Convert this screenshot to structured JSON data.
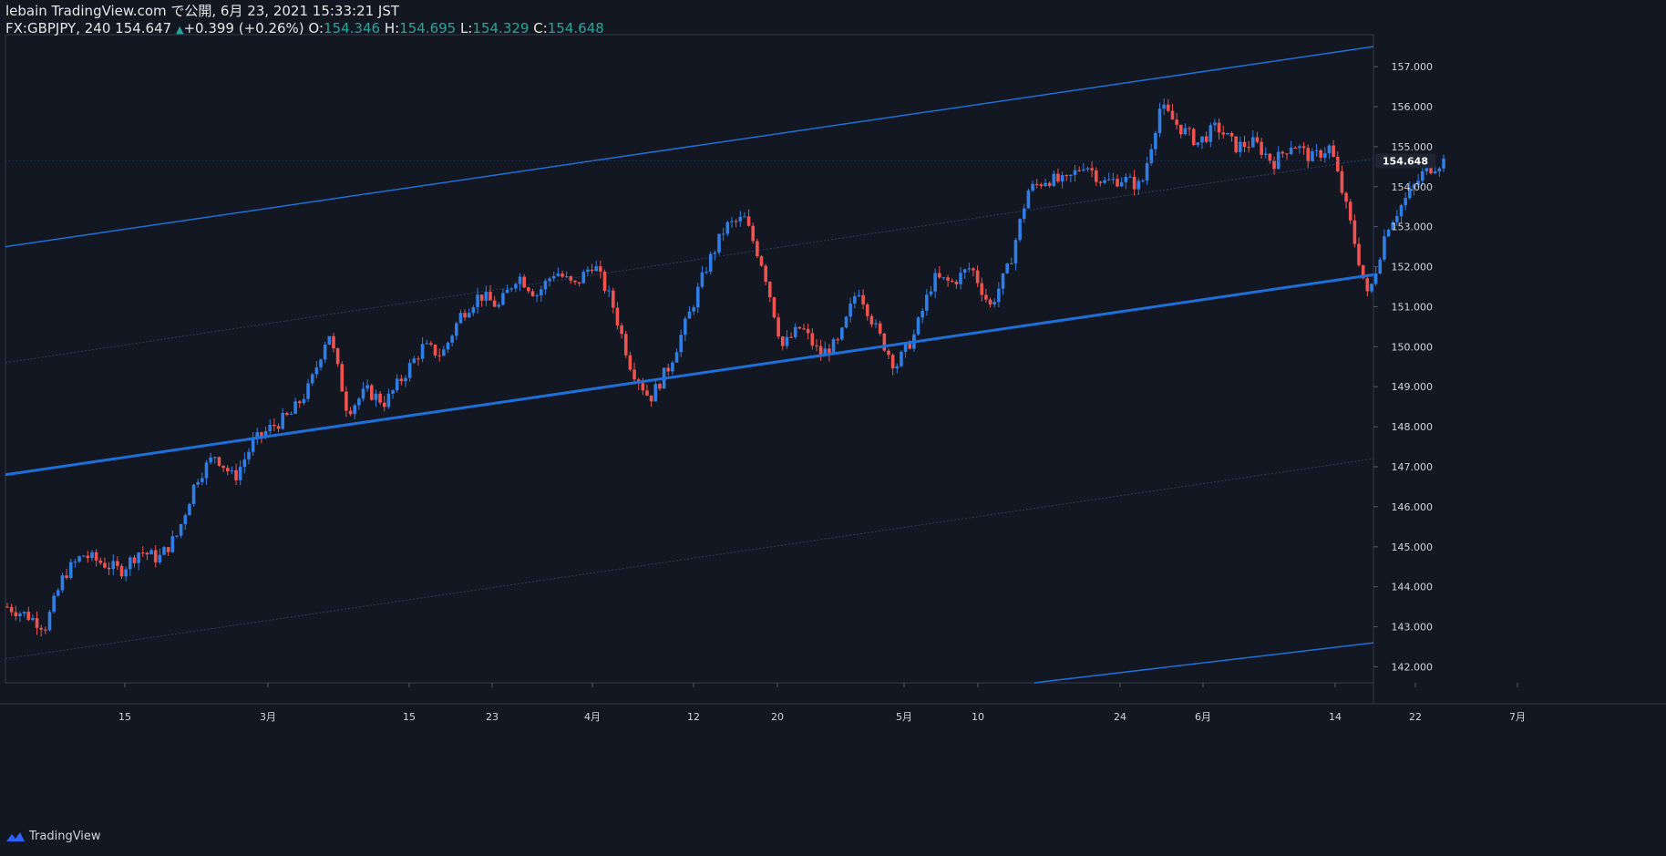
{
  "header": {
    "line1": "lebain TradingView.com で公開, 6月 23, 2021 15:33:21 JST",
    "symbol": "FX:GBPJPY, 240 154.647",
    "change_arrow": "▲",
    "change": "+0.399 (+0.26%)",
    "o_label": "O:",
    "o_value": "154.346",
    "h_label": "H:",
    "h_value": "154.695",
    "l_label": "L:",
    "l_value": "154.329",
    "c_label": "C:",
    "c_value": "154.648"
  },
  "footer": {
    "brand": "TradingView"
  },
  "colors": {
    "background": "#131722",
    "up": "#2962ff",
    "up_light": "#2f7ee6",
    "down": "#ef5350",
    "channel": "#1e6fd9",
    "axis_text": "#d1d4dc",
    "price_badge": "#1f2433"
  },
  "chart_data": {
    "type": "candlestick",
    "symbol": "FX:GBPJPY",
    "timeframe": "240",
    "y_axis": {
      "ticks": [
        "142.000",
        "143.000",
        "144.000",
        "145.000",
        "146.000",
        "147.000",
        "148.000",
        "149.000",
        "150.000",
        "151.000",
        "152.000",
        "153.000",
        "154.000",
        "155.000",
        "156.000",
        "157.000"
      ],
      "range": [
        141.6,
        157.8
      ]
    },
    "x_axis": {
      "ticks": [
        "15",
        "3月",
        "15",
        "23",
        "4月",
        "12",
        "20",
        "5月",
        "10",
        "24",
        "6月",
        "14",
        "22",
        "7月"
      ]
    },
    "last_price_label": "154.648",
    "price_path": [
      143.5,
      143.3,
      143.0,
      144.3,
      144.8,
      144.6,
      144.4,
      144.9,
      144.7,
      145.3,
      146.7,
      147.3,
      146.7,
      147.6,
      148.0,
      148.3,
      149.0,
      150.4,
      148.4,
      148.9,
      148.6,
      149.3,
      150.0,
      149.8,
      150.8,
      151.3,
      151.0,
      151.8,
      151.3,
      151.9,
      151.5,
      152.1,
      151.1,
      149.5,
      148.7,
      149.5,
      150.7,
      152.0,
      153.0,
      153.2,
      152.0,
      150.0,
      150.5,
      149.8,
      150.1,
      151.5,
      150.4,
      149.5,
      150.3,
      151.7,
      151.6,
      152.0,
      151.0,
      152.0,
      153.9,
      154.2,
      154.1,
      154.6,
      154.1,
      154.2,
      154.0,
      156.0,
      155.5,
      155.1,
      155.5,
      155.0,
      155.1,
      154.6,
      155.1,
      154.7,
      155.0,
      153.2,
      151.2,
      153.0,
      153.7,
      154.4,
      154.65
    ],
    "channel_lines": [
      {
        "style": "thin",
        "from": [
          0,
          152.5
        ],
        "to": [
          1,
          157.5
        ]
      },
      {
        "style": "thick",
        "from": [
          0,
          146.8
        ],
        "to": [
          1,
          151.8
        ]
      },
      {
        "style": "thin",
        "from": [
          0.752,
          141.6
        ],
        "to": [
          1,
          142.6
        ]
      }
    ],
    "guide_lines": [
      {
        "from": [
          0,
          149.6
        ],
        "to": [
          1,
          154.7
        ]
      },
      {
        "from": [
          0,
          142.2
        ],
        "to": [
          1,
          147.2
        ]
      }
    ]
  }
}
